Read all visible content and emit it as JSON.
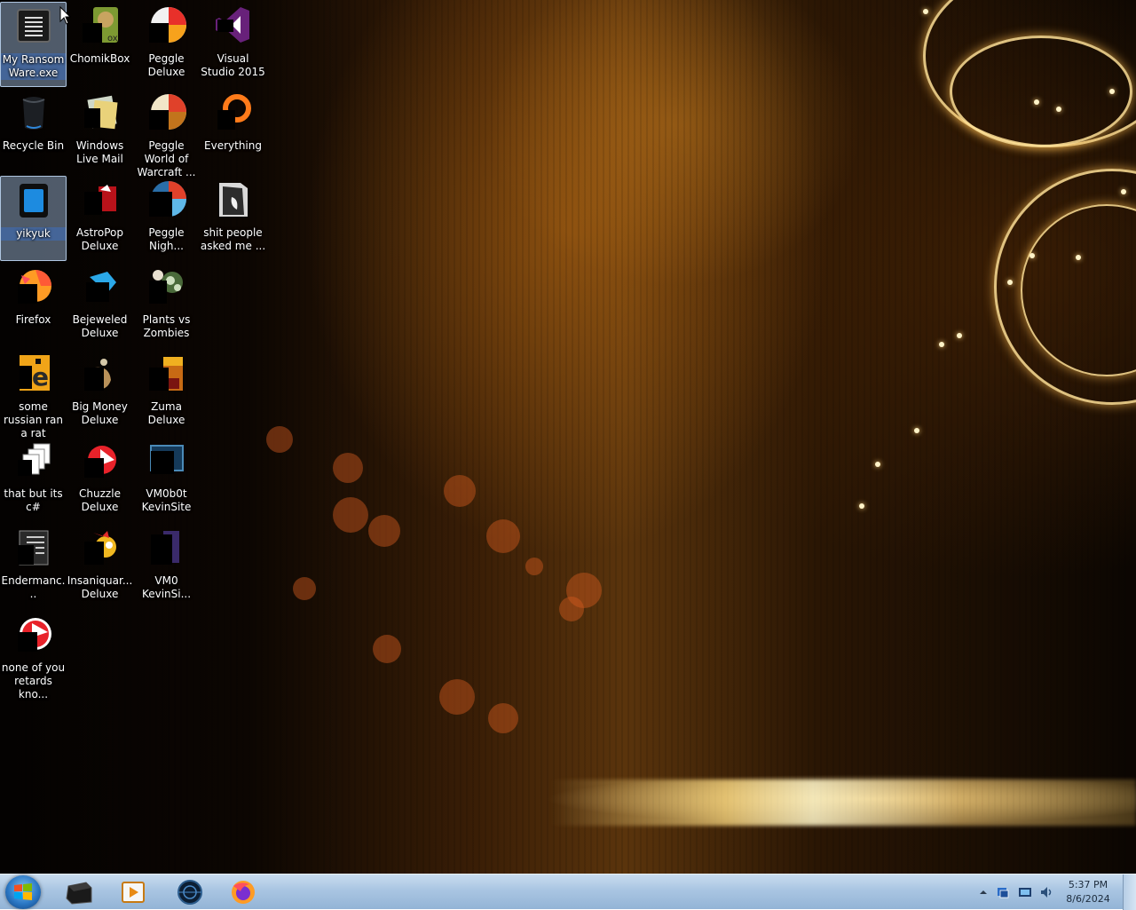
{
  "desktop": {
    "icons": [
      {
        "label": "My Ransom Ware.exe",
        "icon": "terminal-icon",
        "selected": true
      },
      {
        "label": "ChomikBox",
        "icon": "chomikbox-icon",
        "selected": false
      },
      {
        "label": "Peggle Deluxe",
        "icon": "peggle-icon",
        "selected": false
      },
      {
        "label": "Visual Studio 2015",
        "icon": "visual-studio-icon",
        "selected": false
      },
      {
        "label": "Recycle Bin",
        "icon": "recycle-bin-icon",
        "selected": false
      },
      {
        "label": "Windows Live Mail",
        "icon": "mail-icon",
        "selected": false
      },
      {
        "label": "Peggle World of Warcraft ...",
        "icon": "peggle-icon",
        "selected": false
      },
      {
        "label": "Everything",
        "icon": "search-everything-icon",
        "selected": false
      },
      {
        "label": "yikyuk",
        "icon": "blue-app-icon",
        "selected": true
      },
      {
        "label": "AstroPop Deluxe",
        "icon": "astropop-icon",
        "selected": false
      },
      {
        "label": "Peggle Nigh...",
        "icon": "peggle-nights-icon",
        "selected": false
      },
      {
        "label": "shit people asked me ...",
        "icon": "folder-icon",
        "selected": false
      },
      {
        "label": "Firefox",
        "icon": "firefox-icon",
        "selected": false
      },
      {
        "label": "Bejeweled Deluxe",
        "icon": "bejeweled-icon",
        "selected": false
      },
      {
        "label": "Plants vs Zombies",
        "icon": "plants-vs-zombies-icon",
        "selected": false
      },
      {
        "label": "some russian ran a rat",
        "icon": "document-icon",
        "selected": false
      },
      {
        "label": "Big Money Deluxe",
        "icon": "big-money-icon",
        "selected": false
      },
      {
        "label": "Zuma Deluxe",
        "icon": "zuma-icon",
        "selected": false
      },
      {
        "label": "that but its c#",
        "icon": "copy-files-icon",
        "selected": false
      },
      {
        "label": "Chuzzle Deluxe",
        "icon": "chuzzle-icon",
        "selected": false
      },
      {
        "label": "VM0b0t KevinSite",
        "icon": "vm-icon",
        "selected": false
      },
      {
        "label": "Endermanc...",
        "icon": "text-file-icon",
        "selected": false
      },
      {
        "label": "Insaniquar... Deluxe",
        "icon": "insaniquarium-icon",
        "selected": false
      },
      {
        "label": "VM0 KevinSi...",
        "icon": "vm-file-icon",
        "selected": false
      },
      {
        "label": "none of you retards kno...",
        "icon": "chuzzle-icon",
        "selected": false
      }
    ]
  },
  "taskbar": {
    "start_icon": "windows-start-icon",
    "pinned": [
      {
        "name": "vm-window-icon"
      },
      {
        "name": "media-player-icon"
      },
      {
        "name": "globe-app-icon"
      },
      {
        "name": "firefox-icon"
      }
    ],
    "tray_icons": [
      "chevron-up-icon",
      "network-icon",
      "display-icon",
      "volume-icon"
    ],
    "time": "5:37 PM",
    "date": "8/6/2024"
  }
}
